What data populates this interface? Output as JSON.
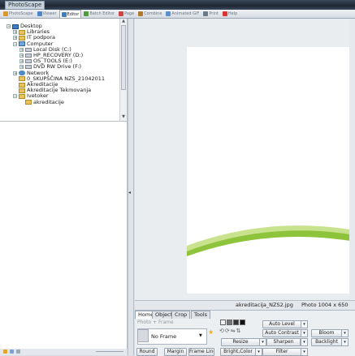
{
  "app": {
    "title": "PhotoScape"
  },
  "tabs": [
    {
      "label": "PhotoScape",
      "icon": "photoscape-icon",
      "color": "#d99a2b",
      "active": false
    },
    {
      "label": "Viewer",
      "icon": "viewer-icon",
      "color": "#4a86c8",
      "active": false
    },
    {
      "label": "Editor",
      "icon": "editor-icon",
      "color": "#3f7fc0",
      "active": true
    },
    {
      "label": "Batch Editor",
      "icon": "batch-editor-icon",
      "color": "#4f9a3a",
      "active": false
    },
    {
      "label": "Page",
      "icon": "page-icon",
      "color": "#c44",
      "active": false
    },
    {
      "label": "Combine",
      "icon": "combine-icon",
      "color": "#b07a30",
      "active": false
    },
    {
      "label": "Animated GIF",
      "icon": "animated-gif-icon",
      "color": "#5a8fcf",
      "active": false
    },
    {
      "label": "Print",
      "icon": "print-icon",
      "color": "#6a7a88",
      "active": false
    },
    {
      "label": "Help",
      "icon": "help-icon",
      "color": "#d33",
      "active": false
    }
  ],
  "tree": [
    {
      "label": "Desktop",
      "icon": "desk",
      "indent": 0,
      "exp": "-"
    },
    {
      "label": "Libraries",
      "icon": "fold",
      "indent": 1,
      "exp": "+"
    },
    {
      "label": "IT podpora",
      "icon": "fold",
      "indent": 1,
      "exp": "+"
    },
    {
      "label": "Computer",
      "icon": "comp",
      "indent": 1,
      "exp": "-"
    },
    {
      "label": "Local Disk (C:)",
      "icon": "drive",
      "indent": 2,
      "exp": "+"
    },
    {
      "label": "HP_RECOVERY (D:)",
      "icon": "drive",
      "indent": 2,
      "exp": "+"
    },
    {
      "label": "OS_TOOLS (E:)",
      "icon": "drive",
      "indent": 2,
      "exp": "+"
    },
    {
      "label": "DVD RW Drive (F:)",
      "icon": "drive",
      "indent": 2,
      "exp": "+"
    },
    {
      "label": "Network",
      "icon": "net",
      "indent": 1,
      "exp": "+"
    },
    {
      "label": "0_SKUPŠČINA NZS_21042011",
      "icon": "fold",
      "indent": 1,
      "exp": ""
    },
    {
      "label": "Akreditacije",
      "icon": "fold",
      "indent": 1,
      "exp": ""
    },
    {
      "label": "Akreditacije Tekmovanja",
      "icon": "fold",
      "indent": 1,
      "exp": ""
    },
    {
      "label": "Ivetoker",
      "icon": "fold",
      "indent": 1,
      "exp": "-"
    },
    {
      "label": "akreditacije",
      "icon": "fold",
      "indent": 2,
      "exp": ""
    }
  ],
  "status": {
    "filename": "akreditacija_NZS2.jpg",
    "info": "Photo 1004 x 650"
  },
  "editor": {
    "tabs": [
      "Home",
      "Object",
      "Crop",
      "Tools"
    ],
    "photo_frame_label": "Photo + Frame",
    "frame_value": "No Frame",
    "buttons": {
      "round": "Round",
      "margin": "Margin",
      "frame_line": "Frame Line",
      "bright_color": "Bright,Color",
      "filter": "Filter",
      "auto_level": "Auto Level",
      "auto_contrast": "Auto Contrast",
      "bloom": "Bloom",
      "resize": "Resize",
      "sharpen": "Sharpen",
      "backlight": "Backlight"
    }
  },
  "colors": {
    "accent": "#3f7fc0",
    "photo_green_dark": "#8ec43c",
    "photo_green_light": "#c9e28e"
  }
}
